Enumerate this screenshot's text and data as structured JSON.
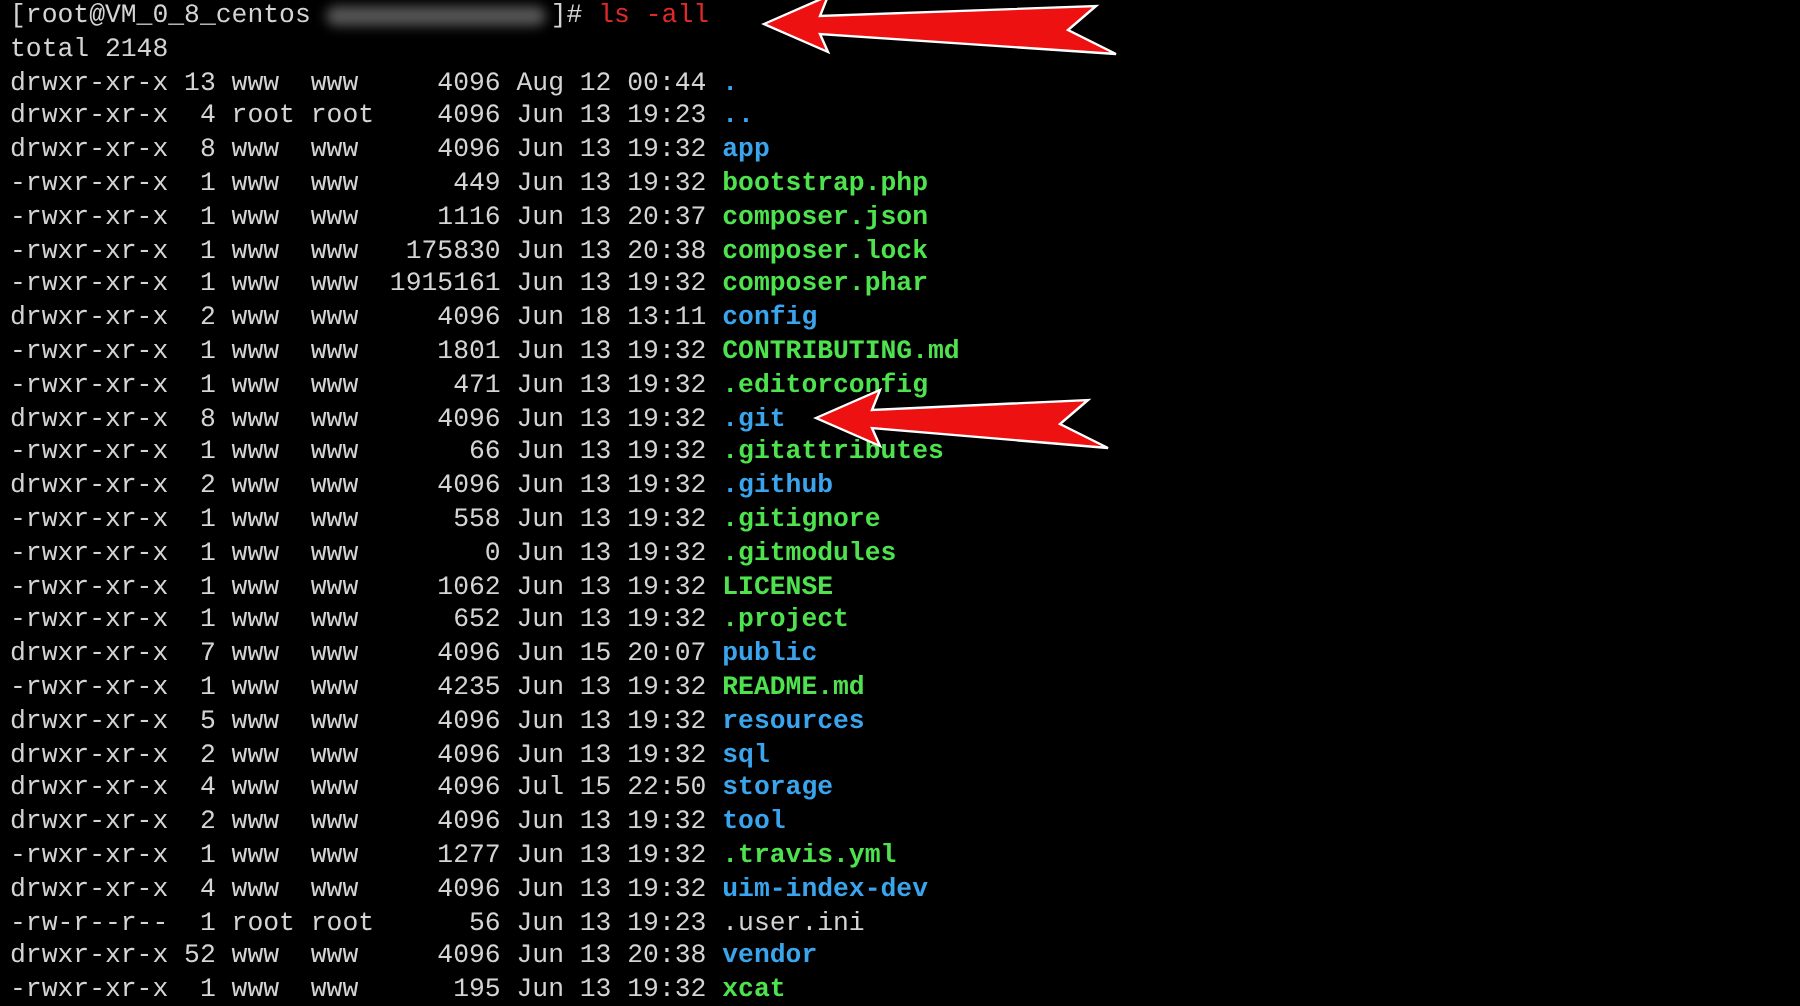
{
  "prompt": {
    "user_host": "[root@VM_0_8_centos",
    "redacted": true,
    "suffix": "]#",
    "command": "ls -all"
  },
  "total": "total 2148",
  "entries": [
    {
      "meta": "drwxr-xr-x 13 www  www     4096 Aug 12 00:44",
      "name": ".",
      "kind": "dir"
    },
    {
      "meta": "drwxr-xr-x  4 root root    4096 Jun 13 19:23",
      "name": "..",
      "kind": "dir"
    },
    {
      "meta": "drwxr-xr-x  8 www  www     4096 Jun 13 19:32",
      "name": "app",
      "kind": "dir"
    },
    {
      "meta": "-rwxr-xr-x  1 www  www      449 Jun 13 19:32",
      "name": "bootstrap.php",
      "kind": "exec"
    },
    {
      "meta": "-rwxr-xr-x  1 www  www     1116 Jun 13 20:37",
      "name": "composer.json",
      "kind": "exec"
    },
    {
      "meta": "-rwxr-xr-x  1 www  www   175830 Jun 13 20:38",
      "name": "composer.lock",
      "kind": "exec"
    },
    {
      "meta": "-rwxr-xr-x  1 www  www  1915161 Jun 13 19:32",
      "name": "composer.phar",
      "kind": "exec"
    },
    {
      "meta": "drwxr-xr-x  2 www  www     4096 Jun 18 13:11",
      "name": "config",
      "kind": "dir"
    },
    {
      "meta": "-rwxr-xr-x  1 www  www     1801 Jun 13 19:32",
      "name": "CONTRIBUTING.md",
      "kind": "exec"
    },
    {
      "meta": "-rwxr-xr-x  1 www  www      471 Jun 13 19:32",
      "name": ".editorconfig",
      "kind": "exec"
    },
    {
      "meta": "drwxr-xr-x  8 www  www     4096 Jun 13 19:32",
      "name": ".git",
      "kind": "dir"
    },
    {
      "meta": "-rwxr-xr-x  1 www  www       66 Jun 13 19:32",
      "name": ".gitattributes",
      "kind": "exec"
    },
    {
      "meta": "drwxr-xr-x  2 www  www     4096 Jun 13 19:32",
      "name": ".github",
      "kind": "dir"
    },
    {
      "meta": "-rwxr-xr-x  1 www  www      558 Jun 13 19:32",
      "name": ".gitignore",
      "kind": "exec"
    },
    {
      "meta": "-rwxr-xr-x  1 www  www        0 Jun 13 19:32",
      "name": ".gitmodules",
      "kind": "exec"
    },
    {
      "meta": "-rwxr-xr-x  1 www  www     1062 Jun 13 19:32",
      "name": "LICENSE",
      "kind": "exec"
    },
    {
      "meta": "-rwxr-xr-x  1 www  www      652 Jun 13 19:32",
      "name": ".project",
      "kind": "exec"
    },
    {
      "meta": "drwxr-xr-x  7 www  www     4096 Jun 15 20:07",
      "name": "public",
      "kind": "dir"
    },
    {
      "meta": "-rwxr-xr-x  1 www  www     4235 Jun 13 19:32",
      "name": "README.md",
      "kind": "exec"
    },
    {
      "meta": "drwxr-xr-x  5 www  www     4096 Jun 13 19:32",
      "name": "resources",
      "kind": "dir"
    },
    {
      "meta": "drwxr-xr-x  2 www  www     4096 Jun 13 19:32",
      "name": "sql",
      "kind": "dir"
    },
    {
      "meta": "drwxr-xr-x  4 www  www     4096 Jul 15 22:50",
      "name": "storage",
      "kind": "dir"
    },
    {
      "meta": "drwxr-xr-x  2 www  www     4096 Jun 13 19:32",
      "name": "tool",
      "kind": "dir"
    },
    {
      "meta": "-rwxr-xr-x  1 www  www     1277 Jun 13 19:32",
      "name": ".travis.yml",
      "kind": "exec"
    },
    {
      "meta": "drwxr-xr-x  4 www  www     4096 Jun 13 19:32",
      "name": "uim-index-dev",
      "kind": "dir"
    },
    {
      "meta": "-rw-r--r--  1 root root      56 Jun 13 19:23",
      "name": ".user.ini",
      "kind": "file"
    },
    {
      "meta": "drwxr-xr-x 52 www  www     4096 Jun 13 20:38",
      "name": "vendor",
      "kind": "dir"
    },
    {
      "meta": "-rwxr-xr-x  1 www  www      195 Jun 13 19:32",
      "name": "xcat",
      "kind": "exec"
    }
  ]
}
